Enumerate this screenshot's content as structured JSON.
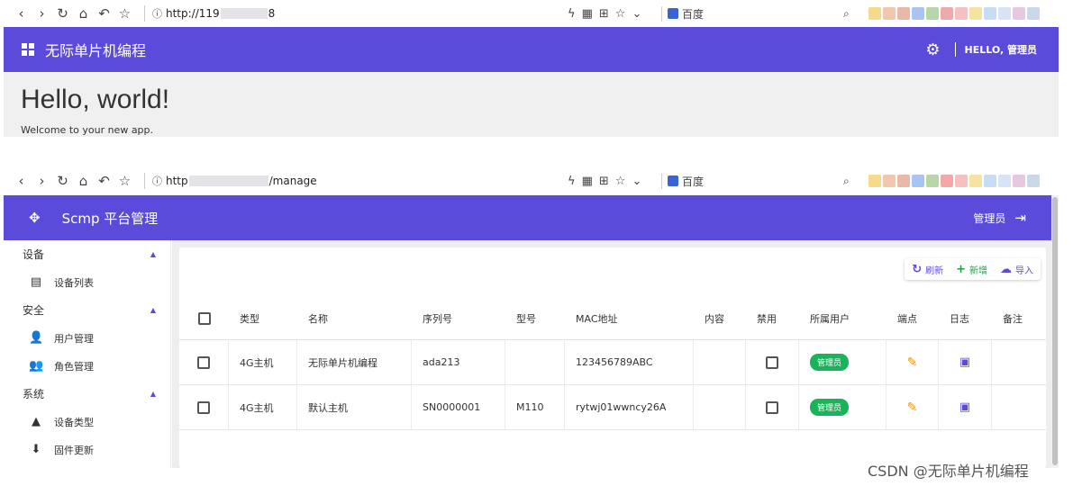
{
  "browser_top": {
    "url_prefix": "http://119",
    "url_suffix": "8",
    "search_engine": "百度"
  },
  "browser_bottom": {
    "url_prefix": "http",
    "url_suffix": "/manage",
    "search_engine": "百度"
  },
  "app1": {
    "title": "无际单片机编程",
    "user_greeting": "HELLO, 管理员",
    "heading": "Hello, world!",
    "subtext": "Welcome to your new app."
  },
  "app2": {
    "title": "Scmp 平台管理",
    "user_name": "管理员",
    "accent_color": "#5b4bdb",
    "sidebar": {
      "groups": [
        {
          "label": "设备",
          "items": [
            {
              "label": "设备列表",
              "icon": "tablet-icon"
            }
          ]
        },
        {
          "label": "安全",
          "items": [
            {
              "label": "用户管理",
              "icon": "user-gear-icon"
            },
            {
              "label": "角色管理",
              "icon": "people-icon"
            }
          ]
        },
        {
          "label": "系统",
          "items": [
            {
              "label": "设备类型",
              "icon": "shapes-icon"
            },
            {
              "label": "固件更新",
              "icon": "download-icon"
            }
          ]
        }
      ]
    },
    "actions": {
      "refresh": "刷新",
      "new": "新增",
      "import": "导入"
    },
    "table": {
      "headers": [
        "类型",
        "名称",
        "序列号",
        "型号",
        "MAC地址",
        "内容",
        "禁用",
        "所属用户",
        "端点",
        "日志",
        "备注"
      ],
      "rows": [
        {
          "type": "4G主机",
          "name": "无际单片机编程",
          "serial": "ada213",
          "model": "",
          "mac": "123456789ABC",
          "content": "",
          "disabled": false,
          "owner": "管理员",
          "note": ""
        },
        {
          "type": "4G主机",
          "name": "默认主机",
          "serial": "SN0000001",
          "model": "M110",
          "mac": "rytwj01wwncy26A",
          "content": "",
          "disabled": false,
          "owner": "管理员",
          "note": ""
        }
      ]
    }
  },
  "watermark": "CSDN @无际单片机编程"
}
